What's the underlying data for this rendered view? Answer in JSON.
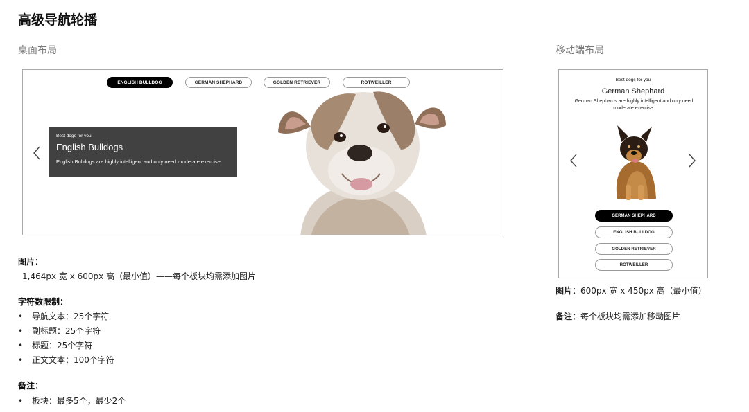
{
  "page": {
    "title": "高级导航轮播",
    "desktop_label": "桌面布局",
    "mobile_label": "移动端布局"
  },
  "desktop": {
    "tabs": [
      "ENGLISH BULLDOG",
      "GERMAN SHEPHARD",
      "GOLDEN RETRIEVER",
      "ROTWEILLER"
    ],
    "active_tab_index": 0,
    "card": {
      "eyebrow": "Best dogs for you",
      "title": "English Bulldogs",
      "body": "English Bulldogs are highly intelligent and only need moderate exercise."
    }
  },
  "mobile": {
    "eyebrow": "Best dogs for you",
    "title": "German Shephard",
    "body": "German Shephards are highly intelligent and only need moderate exercise.",
    "tabs": [
      "GERMAN SHEPHARD",
      "ENGLISH BULLDOG",
      "GOLDEN RETRIEVER",
      "ROTWEILLER"
    ],
    "active_tab_index": 0
  },
  "notes": {
    "image_heading": "图片：",
    "image_spec": "1,464px 宽 x 600px 高（最小值）——每个板块均需添加图片",
    "char_heading": "字符数限制：",
    "char_limits": [
      "导航文本：25个字符",
      "副标题：25个字符",
      "标题：25个字符",
      "正文文本：100个字符"
    ],
    "remark_heading": "备注：",
    "remark_items": [
      "板块：最多5个，最少2个"
    ],
    "mobile_image_label": "图片：",
    "mobile_image_spec": "600px 宽 x 450px 高（最小值）",
    "mobile_remark_label": "备注：",
    "mobile_remark_text": "每个板块均需添加移动图片"
  },
  "bullet_glyph": "•",
  "colors": {
    "card_bg": "#414141",
    "active_pill": "#000000",
    "frame_border": "#a9a9a9"
  }
}
